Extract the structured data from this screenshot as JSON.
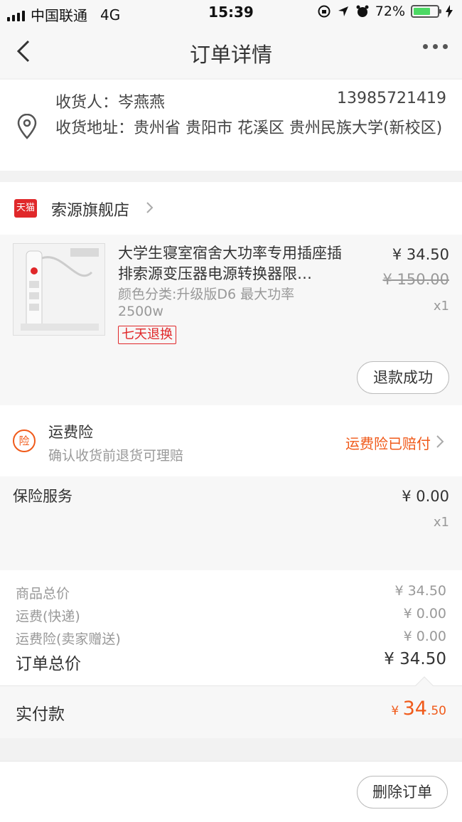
{
  "status_bar": {
    "carrier": "中国联通",
    "network": "4G",
    "time": "15:39",
    "battery_percent": "72%",
    "battery_level": 0.72
  },
  "nav": {
    "title": "订单详情"
  },
  "address": {
    "recipient_label": "收货人：",
    "recipient": "岑燕燕",
    "phone": "13985721419",
    "address_label": "收货地址：",
    "address": "贵州省 贵阳市 花溪区 贵州民族大学(新校区)"
  },
  "shop": {
    "logo_text": "天猫",
    "name": "索源旗舰店"
  },
  "product": {
    "title": "大学生寝室宿舍大功率专用插座插排索源变压器电源转换器限…",
    "spec": "颜色分类:升级版D6 最大功率2500w",
    "tag": "七天退换",
    "price": "¥ 34.50",
    "original_price": "¥ 150.00",
    "quantity": "x1",
    "refund_status": "退款成功"
  },
  "insurance": {
    "badge": "险",
    "label": "运费险",
    "sub": "确认收货前退货可理赔",
    "status": "运费险已赔付"
  },
  "service": {
    "label": "保险服务",
    "price": "¥ 0.00",
    "quantity": "x1"
  },
  "summary": {
    "items": [
      {
        "label": "商品总价",
        "value": "¥ 34.50"
      },
      {
        "label": "运费(快递)",
        "value": "¥ 0.00"
      },
      {
        "label": "运费险(卖家赠送)",
        "value": "¥ 0.00"
      }
    ],
    "total_label": "订单总价",
    "total_value": "¥ 34.50"
  },
  "paid": {
    "label": "实付款",
    "currency": "¥ ",
    "integer": "34",
    "decimal": ".50"
  },
  "footer": {
    "delete_label": "删除订单"
  },
  "colors": {
    "accent": "#f05a1a",
    "tmall_red": "#e0282a"
  }
}
